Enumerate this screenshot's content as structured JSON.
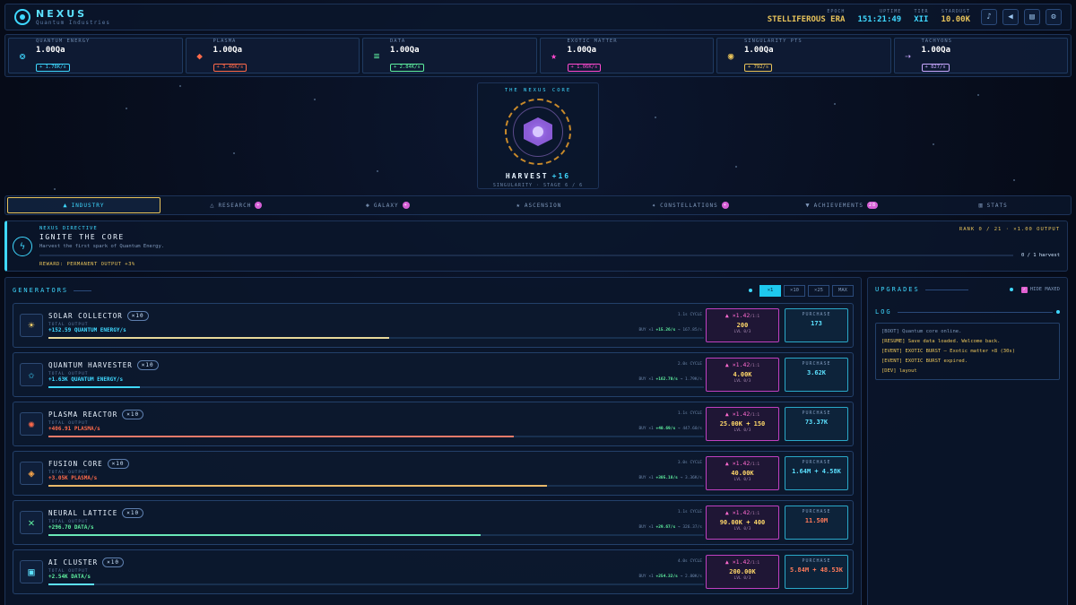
{
  "app": {
    "name": "NEXUS",
    "subtitle": "Quantum Industries"
  },
  "header_stats": [
    {
      "label": "EPOCH",
      "value": "STELLIFEROUS ERA",
      "color": "#e8c35a"
    },
    {
      "label": "UPTIME",
      "value": "151:21:49",
      "color": "#3fd8ff"
    },
    {
      "label": "TIER",
      "value": "XII",
      "color": "#3fd8ff"
    },
    {
      "label": "STARDUST",
      "value": "10.00K",
      "color": "#e8c35a"
    }
  ],
  "header_buttons": [
    {
      "name": "music-button",
      "icon": "♪"
    },
    {
      "name": "sound-button",
      "icon": "◀"
    },
    {
      "name": "notes-button",
      "icon": "▤"
    },
    {
      "name": "settings-button",
      "icon": "⚙"
    }
  ],
  "resources": [
    {
      "label": "QUANTUM ENERGY",
      "value": "1.00Qa",
      "rate": "+ 1.78K/s",
      "icon": "atom-icon",
      "glyph": "❂",
      "color": "#3fd8ff"
    },
    {
      "label": "PLASMA",
      "value": "1.00Qa",
      "rate": "+ 3.46K/s",
      "icon": "flame-icon",
      "glyph": "◆",
      "color": "#ff6a4a"
    },
    {
      "label": "DATA",
      "value": "1.00Qa",
      "rate": "+ 2.84K/s",
      "icon": "data-bars-icon",
      "glyph": "≡",
      "color": "#5ff0a0"
    },
    {
      "label": "EXOTIC MATTER",
      "value": "1.00Qa",
      "rate": "+ 1.06K/s",
      "icon": "star-icon",
      "glyph": "★",
      "color": "#ff4ad0"
    },
    {
      "label": "SINGULARITY PTS",
      "value": "1.00Qa",
      "rate": "+ 792/s",
      "icon": "singularity-icon",
      "glyph": "◉",
      "color": "#e8c35a"
    },
    {
      "label": "TACHYONS",
      "value": "1.00Qa",
      "rate": "+ 827/s",
      "icon": "tachyon-icon",
      "glyph": "⇢",
      "color": "#c8a8ff"
    }
  ],
  "core": {
    "title": "THE NEXUS CORE",
    "action": "HARVEST",
    "gain": "+16",
    "stage": "SINGULARITY · STAGE 6 / 6"
  },
  "tabs": [
    {
      "label": "INDUSTRY",
      "icon": "factory-icon",
      "glyph": "▲",
      "badge": "",
      "active": true
    },
    {
      "label": "RESEARCH",
      "icon": "flask-icon",
      "glyph": "△",
      "badge": "+",
      "active": false
    },
    {
      "label": "GALAXY",
      "icon": "galaxy-icon",
      "glyph": "◈",
      "badge": "+",
      "active": false
    },
    {
      "label": "ASCENSION",
      "icon": "ascension-star-icon",
      "glyph": "★",
      "badge": "",
      "active": false
    },
    {
      "label": "CONSTELLATIONS",
      "icon": "constellation-icon",
      "glyph": "✦",
      "badge": "+",
      "active": false
    },
    {
      "label": "ACHIEVEMENTS",
      "icon": "trophy-icon",
      "glyph": "▼",
      "badge": "28",
      "active": false
    },
    {
      "label": "STATS",
      "icon": "stats-icon",
      "glyph": "▥",
      "badge": "",
      "active": false
    }
  ],
  "directive": {
    "kicker": "NEXUS DIRECTIVE",
    "title": "IGNITE THE CORE",
    "description": "Harvest the first spark of Quantum Energy.",
    "reward": "REWARD: PERMANENT OUTPUT +3%",
    "rank": "RANK 0 / 21 · ×1.00 OUTPUT",
    "progress": "0 / 1 harvest",
    "progress_fraction": 0
  },
  "generators_panel": {
    "title": "GENERATORS",
    "quantities": [
      "×1",
      "×10",
      "×25",
      "MAX"
    ],
    "selected_quantity": "×1"
  },
  "generators": [
    {
      "name": "SOLAR COLLECTOR",
      "owned": "×10",
      "icon": "sun-icon",
      "glyph": "☀",
      "icon_color": "#ffd86a",
      "total_label": "TOTAL OUTPUT",
      "output": "+152.59 QUANTUM ENERGY/s",
      "output_color": "#3fd8ff",
      "cycle": "1.1s CYCLE",
      "buy_prefix": "BUY ×1",
      "buy_gain": "+15.26/s",
      "buy_suffix": "→ 167.85/s",
      "mult": "▲ ×1.42",
      "mult_unit": "/1:1",
      "mult_cost": "200",
      "level": "LVL 0/3",
      "purchase_label": "PURCHASE",
      "cost": "173",
      "cost_red": false,
      "progress": 0.52,
      "bar_color": "#e8d89a"
    },
    {
      "name": "QUANTUM HARVESTER",
      "owned": "×10",
      "icon": "star-outline-icon",
      "glyph": "✩",
      "icon_color": "#3fd8ff",
      "total_label": "TOTAL OUTPUT",
      "output": "+1.63K QUANTUM ENERGY/s",
      "output_color": "#3fd8ff",
      "cycle": "2.0s CYCLE",
      "buy_prefix": "BUY ×1",
      "buy_gain": "+162.70/s",
      "buy_suffix": "→ 1.79K/s",
      "mult": "▲ ×1.42",
      "mult_unit": "/1:1",
      "mult_cost": "4.00K",
      "level": "LVL 0/3",
      "purchase_label": "PURCHASE",
      "cost": "3.62K",
      "cost_red": false,
      "progress": 0.14,
      "bar_color": "#3fd8ff"
    },
    {
      "name": "PLASMA REACTOR",
      "owned": "×10",
      "icon": "reactor-icon",
      "glyph": "✺",
      "icon_color": "#ff6a4a",
      "total_label": "TOTAL OUTPUT",
      "output": "+406.91 PLASMA/s",
      "output_color": "#ff6a4a",
      "cycle": "1.1s CYCLE",
      "buy_prefix": "BUY ×1",
      "buy_gain": "+40.69/s",
      "buy_suffix": "→ 447.60/s",
      "mult": "▲ ×1.42",
      "mult_unit": "/1:1",
      "mult_cost": "25.00K + 150",
      "level": "LVL 0/3",
      "purchase_label": "PURCHASE",
      "cost": "73.37K",
      "cost_red": false,
      "progress": 0.71,
      "bar_color": "#e87a6a"
    },
    {
      "name": "FUSION CORE",
      "owned": "×10",
      "icon": "fusion-diamond-icon",
      "glyph": "◈",
      "icon_color": "#ffa84a",
      "total_label": "TOTAL OUTPUT",
      "output": "+3.05K PLASMA/s",
      "output_color": "#ff6a4a",
      "cycle": "3.0s CYCLE",
      "buy_prefix": "BUY ×1",
      "buy_gain": "+305.18/s",
      "buy_suffix": "→ 3.36K/s",
      "mult": "▲ ×1.42",
      "mult_unit": "/1:1",
      "mult_cost": "40.00K",
      "level": "LVL 0/3",
      "purchase_label": "PURCHASE",
      "cost": "1.64M + 4.58K",
      "cost_red": false,
      "progress": 0.76,
      "bar_color": "#e8b86a"
    },
    {
      "name": "NEURAL LATTICE",
      "owned": "×10",
      "icon": "network-icon",
      "glyph": "✕",
      "icon_color": "#5ff0a0",
      "total_label": "TOTAL OUTPUT",
      "output": "+296.70 DATA/s",
      "output_color": "#5ff0a0",
      "cycle": "1.1s CYCLE",
      "buy_prefix": "BUY ×1",
      "buy_gain": "+29.67/s",
      "buy_suffix": "→ 326.37/s",
      "mult": "▲ ×1.42",
      "mult_unit": "/1:1",
      "mult_cost": "90.00K + 400",
      "level": "LVL 0/3",
      "purchase_label": "PURCHASE",
      "cost": "11.50M",
      "cost_red": true,
      "progress": 0.66,
      "bar_color": "#6ae8b8"
    },
    {
      "name": "AI CLUSTER",
      "owned": "×10",
      "icon": "chip-icon",
      "glyph": "▣",
      "icon_color": "#5ce1ff",
      "total_label": "TOTAL OUTPUT",
      "output": "+2.54K DATA/s",
      "output_color": "#5ff0a0",
      "cycle": "4.0s CYCLE",
      "buy_prefix": "BUY ×1",
      "buy_gain": "+254.32/s",
      "buy_suffix": "→ 2.80K/s",
      "mult": "▲ ×1.42",
      "mult_unit": "/1:1",
      "mult_cost": "200.00K",
      "level": "LVL 0/3",
      "purchase_label": "PURCHASE",
      "cost": "5.84M + 48.53K",
      "cost_red": true,
      "progress": 0.07,
      "bar_color": "#5ce1ff"
    }
  ],
  "upgrades": {
    "title": "UPGRADES",
    "hide_maxed_label": "HIDE MAXED",
    "hide_maxed_checked": true
  },
  "log": {
    "title": "LOG",
    "lines": [
      {
        "text": "[BOOT] Quantum core online.",
        "type": "boot"
      },
      {
        "text": "[RESUME] Save data loaded. Welcome back.",
        "type": "event"
      },
      {
        "text": "[EVENT] EXOTIC BURST — Exotic matter ×8 (30s)",
        "type": "event"
      },
      {
        "text": "[EVENT] EXOTIC BURST expired.",
        "type": "event"
      },
      {
        "text": "[DEV] layout",
        "type": "event"
      }
    ]
  }
}
